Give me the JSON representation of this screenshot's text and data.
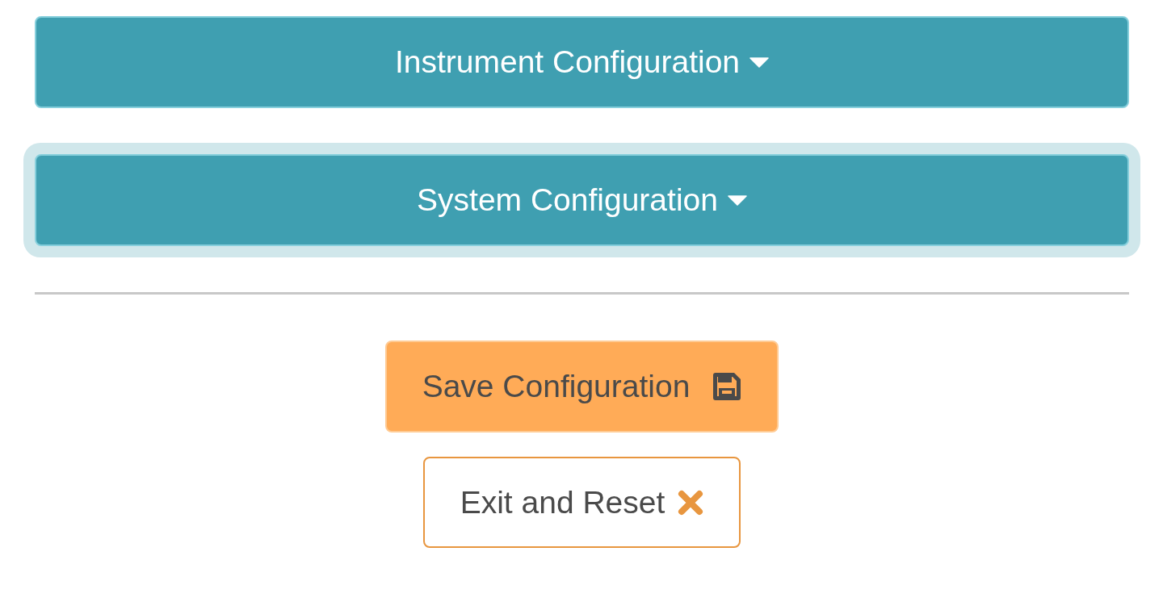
{
  "sections": [
    {
      "label": "Instrument Configuration",
      "focused": false
    },
    {
      "label": "System Configuration",
      "focused": true
    }
  ],
  "actions": [
    {
      "label": "Save Configuration",
      "kind": "primary"
    },
    {
      "label": "Exit and Reset",
      "kind": "outline"
    }
  ]
}
